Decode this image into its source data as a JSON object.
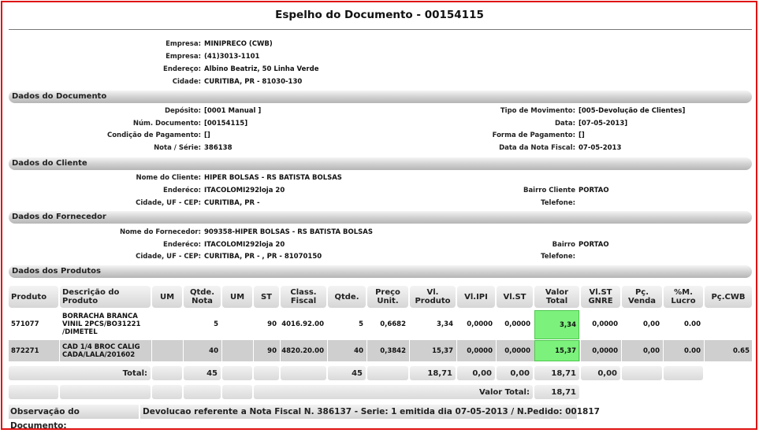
{
  "title": "Espelho do Documento - 00154115",
  "company": [
    {
      "label": "Empresa:",
      "value": "MINIPRECO (CWB)"
    },
    {
      "label": "Empresa:",
      "value": "(41)3013-1101"
    },
    {
      "label": "Endereço:",
      "value": "Albino Beatriz, 50 Linha Verde"
    },
    {
      "label": "Cidade:",
      "value": "CURITIBA, PR - 81030-130"
    }
  ],
  "sections": {
    "documento": "Dados do Documento",
    "cliente": "Dados do Cliente",
    "fornecedor": "Dados do Fornecedor",
    "produtos": "Dados dos Produtos"
  },
  "documento": {
    "left": [
      {
        "label": "Depósito:",
        "value": "[0001 Manual ]"
      },
      {
        "label": "Núm. Documento:",
        "value": "[00154115]"
      },
      {
        "label": "Condição de Pagamento:",
        "value": "[]"
      },
      {
        "label": "Nota / Série:",
        "value": "386138"
      }
    ],
    "right": [
      {
        "label": "Tipo de Movimento:",
        "value": "[005-Devolução de Clientes]"
      },
      {
        "label": "Data:",
        "value": "[07-05-2013]"
      },
      {
        "label": "Forma de Pagamento:",
        "value": "[]"
      },
      {
        "label": "Data da Nota Fiscal:",
        "value": "07-05-2013"
      }
    ]
  },
  "cliente": {
    "left": [
      {
        "label": "Nome do Cliente:",
        "value": "HIPER BOLSAS - RS BATISTA BOLSAS"
      },
      {
        "label": "Enderéco:",
        "value": "ITACOLOMI292loja 20"
      },
      {
        "label": "Cidade, UF - CEP:",
        "value": "CURITIBA, PR -"
      }
    ],
    "right": [
      {
        "label": "Bairro Cliente",
        "value": "PORTAO"
      },
      {
        "label": "Telefone:",
        "value": ""
      }
    ]
  },
  "fornecedor": {
    "left": [
      {
        "label": "Nome do Fornecedor:",
        "value": "909358-HIPER BOLSAS - RS BATISTA BOLSAS"
      },
      {
        "label": "Enderéco:",
        "value": "ITACOLOMI292loja 20"
      },
      {
        "label": "Cidade, UF - CEP:",
        "value": "CURITIBA, PR - , PR - 81070150"
      }
    ],
    "right": [
      {
        "label": "Bairro",
        "value": "PORTAO"
      },
      {
        "label": "Telefone:",
        "value": ""
      }
    ]
  },
  "table": {
    "headers": [
      "Produto",
      "Descrição do Produto",
      "UM",
      "Qtde. Nota",
      "UM",
      "ST",
      "Class. Fiscal",
      "Qtde.",
      "Preço Unit.",
      "Vl. Produto",
      "Vl.IPI",
      "Vl.ST",
      "Valor Total",
      "Vl.ST GNRE",
      "Pç. Venda",
      "%M. Lucro",
      "Pç.CWB"
    ],
    "rows": [
      [
        "571077",
        "BORRACHA BRANCA VINIL 2PCS/BO31221 /DIMETEL",
        "",
        "5",
        "",
        "90",
        "4016.92.00",
        "5",
        "0,6682",
        "3,34",
        "0,0000",
        "0,0000",
        "3,34",
        "0,0000",
        "0,00",
        "0.00",
        ""
      ],
      [
        "872271",
        "CAD 1/4 BROC CALIG CADA/LALA/201602",
        "",
        "40",
        "",
        "90",
        "4820.20.00",
        "40",
        "0,3842",
        "15,37",
        "0,0000",
        "0,0000",
        "15,37",
        "0,0000",
        "0,00",
        "0.00",
        "0.65"
      ]
    ],
    "totals": {
      "label": "Total:",
      "qtde_nota": "45",
      "qtde": "45",
      "vl_produto": "18,71",
      "vl_ipi": "0,00",
      "vl_st": "0,00",
      "valor_total": "18,71",
      "vl_st_gnre": "0,00"
    },
    "valor_total": {
      "label": "Valor Total:",
      "value": "18,71"
    }
  },
  "observacao": {
    "label": "Observação do Documento:",
    "value": "Devolucao referente a Nota Fiscal N. 386137 - Serie: 1 emitida dia 07-05-2013 / N.Pedido: 001817"
  },
  "colors": {
    "border": "#e01010",
    "highlight": "#7cf27c"
  }
}
